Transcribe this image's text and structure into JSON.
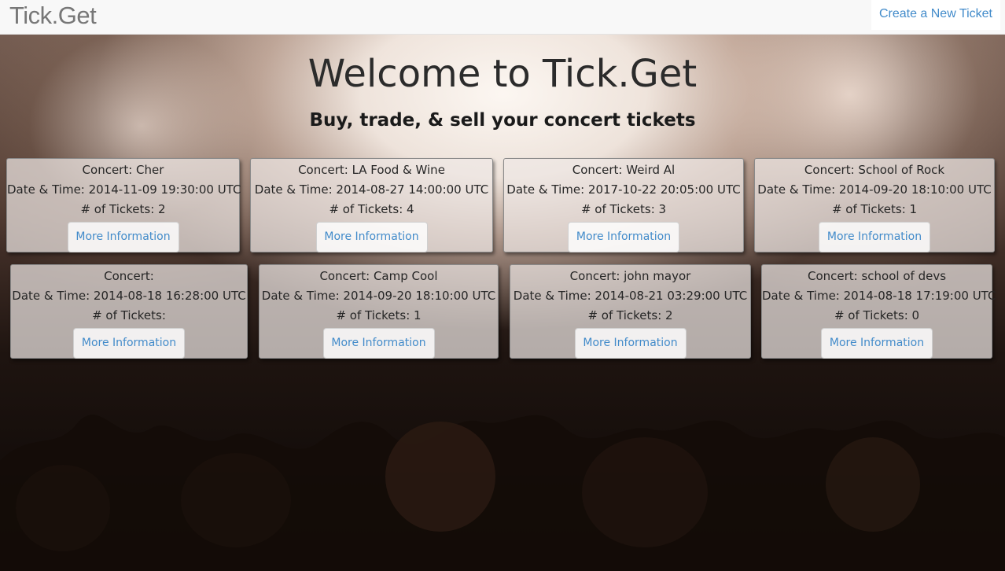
{
  "navbar": {
    "brand": "Tick.Get",
    "create_link": "Create a New Ticket"
  },
  "hero": {
    "title": "Welcome to Tick.Get",
    "subtitle": "Buy, trade, & sell your concert tickets"
  },
  "tickets": [
    {
      "concert": "Concert: Cher",
      "datetime": "Date & Time: 2014-11-09 19:30:00 UTC",
      "count": "# of Tickets: 2",
      "button": "More Information"
    },
    {
      "concert": "Concert: LA Food & Wine",
      "datetime": "Date & Time: 2014-08-27 14:00:00 UTC",
      "count": "# of Tickets: 4",
      "button": "More Information"
    },
    {
      "concert": "Concert: Weird Al",
      "datetime": "Date & Time: 2017-10-22 20:05:00 UTC",
      "count": "# of Tickets: 3",
      "button": "More Information"
    },
    {
      "concert": "Concert: School of Rock",
      "datetime": "Date & Time: 2014-09-20 18:10:00 UTC",
      "count": "# of Tickets: 1",
      "button": "More Information"
    },
    {
      "concert": "Concert:",
      "datetime": "Date & Time: 2014-08-18 16:28:00 UTC",
      "count": "# of Tickets:",
      "button": "More Information"
    },
    {
      "concert": "Concert: Camp Cool",
      "datetime": "Date & Time: 2014-09-20 18:10:00 UTC",
      "count": "# of Tickets: 1",
      "button": "More Information"
    },
    {
      "concert": "Concert: john mayor",
      "datetime": "Date & Time: 2014-08-21 03:29:00 UTC",
      "count": "# of Tickets: 2",
      "button": "More Information"
    },
    {
      "concert": "Concert: school of devs",
      "datetime": "Date & Time: 2014-08-18 17:19:00 UTC",
      "count": "# of Tickets: 0",
      "button": "More Information"
    }
  ],
  "colors": {
    "link": "#428bca",
    "navbar_bg": "#f8f8f8",
    "brand": "#777777"
  }
}
